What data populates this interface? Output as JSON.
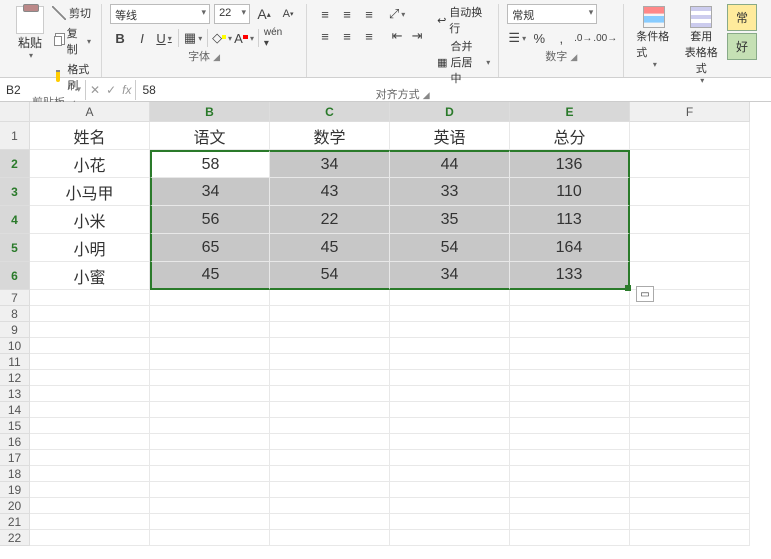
{
  "ribbon": {
    "clipboard": {
      "paste": "粘贴",
      "cut": "剪切",
      "copy": "复制",
      "format_painter": "格式刷",
      "group_label": "剪贴板"
    },
    "font": {
      "name": "等线",
      "size": "22",
      "group_label": "字体",
      "inc_font": "A",
      "dec_font": "A"
    },
    "align": {
      "wrap": "自动换行",
      "merge": "合并后居中",
      "group_label": "对齐方式"
    },
    "number": {
      "format": "常规",
      "group_label": "数字"
    },
    "styles": {
      "cond_fmt": "条件格式",
      "table_fmt": "套用\n表格格式",
      "good": "好",
      "chang": "常"
    }
  },
  "namebox": "B2",
  "formula_value": "58",
  "columns": [
    "A",
    "B",
    "C",
    "D",
    "E",
    "F"
  ],
  "rows": [
    "1",
    "2",
    "3",
    "4",
    "5",
    "6",
    "7",
    "8",
    "9",
    "10",
    "11",
    "12",
    "13",
    "14",
    "15",
    "16",
    "17",
    "18",
    "19",
    "20",
    "21",
    "22"
  ],
  "chart_data": {
    "type": "table",
    "headers": [
      "姓名",
      "语文",
      "数学",
      "英语",
      "总分"
    ],
    "rows": [
      {
        "name": "小花",
        "chinese": 58,
        "math": 34,
        "english": 44,
        "total": 136
      },
      {
        "name": "小马甲",
        "chinese": 34,
        "math": 43,
        "english": 33,
        "total": 110
      },
      {
        "name": "小米",
        "chinese": 56,
        "math": 22,
        "english": 35,
        "total": 113
      },
      {
        "name": "小明",
        "chinese": 65,
        "math": 45,
        "english": 54,
        "total": 164
      },
      {
        "name": "小蜜",
        "chinese": 45,
        "math": 54,
        "english": 34,
        "total": 133
      }
    ]
  },
  "colors": {
    "selection_border": "#2a7a2a",
    "ribbon_bg": "#f5f5f5"
  }
}
